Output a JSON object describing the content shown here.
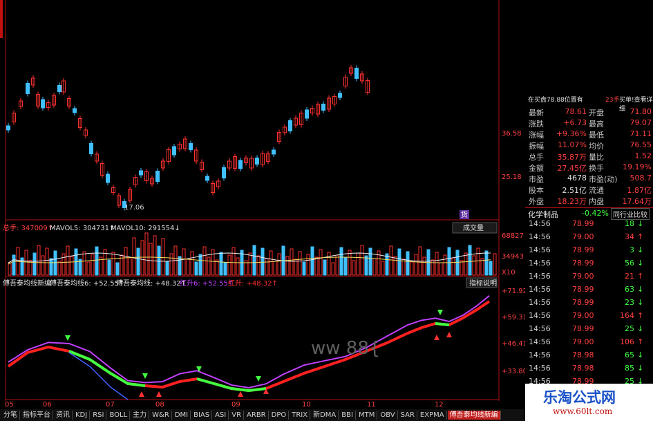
{
  "info_line": {
    "vol_label": "总手: 347009↑",
    "mavol5": "MAVOL5: 304731↑",
    "mavol10": "MAVOL10: 291554↓"
  },
  "indicator_line": {
    "name": "傅吾泰均线新编",
    "a": "傅吾泰均线6: +52.55↑",
    "b": "傅吾泰均线: +48.32↑",
    "c": "红升6: +52.55↑",
    "d": "红升: +48.32↑"
  },
  "price_axis": [
    "36.58",
    "25.18"
  ],
  "price_low_label": "17.06",
  "vol_axis": [
    "68827",
    "34943",
    "X10"
  ],
  "ind_axis": [
    "+71.92",
    "+59.31",
    "+46.41",
    "+33.80"
  ],
  "date_labels": [
    "05",
    "06",
    "07",
    "08",
    "09",
    "10",
    "11",
    "12"
  ],
  "vol_dropdown": "成交量",
  "indicator_button": "指标说明",
  "watermark_text": "ww 88{",
  "buy_badge": "货",
  "quote_header": {
    "left": "在买盘78.88位置有",
    "mid": "23手",
    "right": "买单!查看详细"
  },
  "quote_rows": [
    {
      "l1": "最新",
      "v1": "78.61",
      "l2": "开盘",
      "v2": "71.80"
    },
    {
      "l1": "涨跌",
      "v1": "+6.73",
      "l2": "最高",
      "v2": "79.07"
    },
    {
      "l1": "涨幅",
      "v1": "+9.36%",
      "l2": "最低",
      "v2": "71.11"
    },
    {
      "l1": "振幅",
      "v1": "11.07%",
      "l2": "均价",
      "v2": "76.55"
    },
    {
      "l1": "总手",
      "v1": "35.87万",
      "l2": "量比",
      "v2": "1.52"
    },
    {
      "l1": "金额",
      "v1": "27.45亿",
      "l2": "换手",
      "v2": "19.19%"
    },
    {
      "l1": "市盈",
      "v1": "4678",
      "l2": "市盈(动)",
      "v2": "508.7"
    },
    {
      "l1": "股本",
      "v1": "2.51亿",
      "l2": "流通",
      "v2": "1.87亿"
    },
    {
      "l1": "外盘",
      "v1": "18.23万",
      "l2": "内盘",
      "v2": "17.64万"
    }
  ],
  "sector": {
    "name": "化学制品",
    "change": "-0.42%",
    "button": "同行业比较"
  },
  "ticks": [
    {
      "t": "14:56",
      "p": "78.99",
      "v": "18",
      "dir": "down"
    },
    {
      "t": "14:56",
      "p": "79.00",
      "v": "34",
      "dir": "up"
    },
    {
      "t": "14:56",
      "p": "78.99",
      "v": "3",
      "dir": "down"
    },
    {
      "t": "14:56",
      "p": "78.99",
      "v": "56",
      "dir": "down"
    },
    {
      "t": "14:56",
      "p": "79.00",
      "v": "21",
      "dir": "up"
    },
    {
      "t": "14:56",
      "p": "78.99",
      "v": "63",
      "dir": "down"
    },
    {
      "t": "14:56",
      "p": "78.99",
      "v": "23",
      "dir": "down"
    },
    {
      "t": "14:56",
      "p": "79.00",
      "v": "164",
      "dir": "up"
    },
    {
      "t": "14:56",
      "p": "78.99",
      "v": "25",
      "dir": "down"
    },
    {
      "t": "14:56",
      "p": "79.00",
      "v": "106",
      "dir": "up"
    },
    {
      "t": "14:56",
      "p": "78.98",
      "v": "65",
      "dir": "down"
    },
    {
      "t": "14:56",
      "p": "78.98",
      "v": "85",
      "dir": "down"
    },
    {
      "t": "14:56",
      "p": "78.99",
      "v": "25",
      "dir": "down"
    }
  ],
  "tabs": [
    "分笔",
    "指标平台",
    "资讯",
    "KDJ",
    "RSI",
    "BOLL",
    "主力",
    "W&R",
    "DMI",
    "BIAS",
    "ASI",
    "VR",
    "ARBR",
    "DPO",
    "TRIX",
    "新DMA",
    "BBI",
    "MTM",
    "OBV",
    "SAR",
    "EXPMA",
    "傅吾泰均线新编"
  ],
  "active_tab": "傅吾泰均线新编",
  "logo": {
    "title": "乐淘公式网",
    "url": "www.60lt.com"
  },
  "colors": {
    "up": "#ff3030",
    "down": "#40c0ff",
    "green_line": "#40ff40",
    "red_line": "#ff2020",
    "purple_line": "#c040ff"
  }
}
